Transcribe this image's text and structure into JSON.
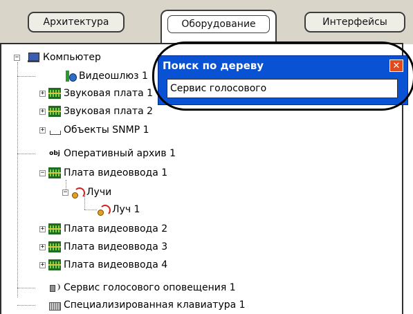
{
  "tabs": [
    {
      "label": "Архитектура",
      "active": false
    },
    {
      "label": "Оборудование",
      "active": true
    },
    {
      "label": "Интерфейсы",
      "active": false
    }
  ],
  "tree": {
    "items": [
      {
        "label": "Компьютер",
        "icon": "computer-icon",
        "expander": "−"
      },
      {
        "label": "Видеошлюз 1",
        "icon": "gateway-icon"
      },
      {
        "label": "Звуковая плата 1",
        "icon": "board-icon",
        "expander": "+"
      },
      {
        "label": "Звуковая плата 2",
        "icon": "board-icon",
        "expander": "+"
      },
      {
        "label": "Объекты SNMP 1",
        "icon": "snmp-icon",
        "expander": "+"
      },
      {
        "label": "Оперативный архив 1",
        "icon": "obj-icon",
        "icon_text": "obj"
      },
      {
        "label": "Плата видеоввода 1",
        "icon": "board-icon",
        "expander": "−"
      },
      {
        "label": "Лучи",
        "icon": "ray-icon",
        "expander": "−"
      },
      {
        "label": "Луч 1",
        "icon": "ray-icon"
      },
      {
        "label": "Плата видеоввода 2",
        "icon": "board-icon",
        "expander": "+"
      },
      {
        "label": "Плата видеоввода 3",
        "icon": "board-icon",
        "expander": "+"
      },
      {
        "label": "Плата видеоввода 4",
        "icon": "board-icon",
        "expander": "+"
      },
      {
        "label": "Сервис голосового оповещения 1",
        "icon": "speaker-icon"
      },
      {
        "label": "Специализированная клавиатура 1",
        "icon": "keyboard-icon"
      }
    ]
  },
  "search_dialog": {
    "title": "Поиск по дереву",
    "close_glyph": "✕",
    "query": "Сервис голосового"
  },
  "colors": {
    "dialog_title_bar": "#0a52d4",
    "close_button": "#e24a1c",
    "toolbar_background": "#d9d6c9"
  }
}
